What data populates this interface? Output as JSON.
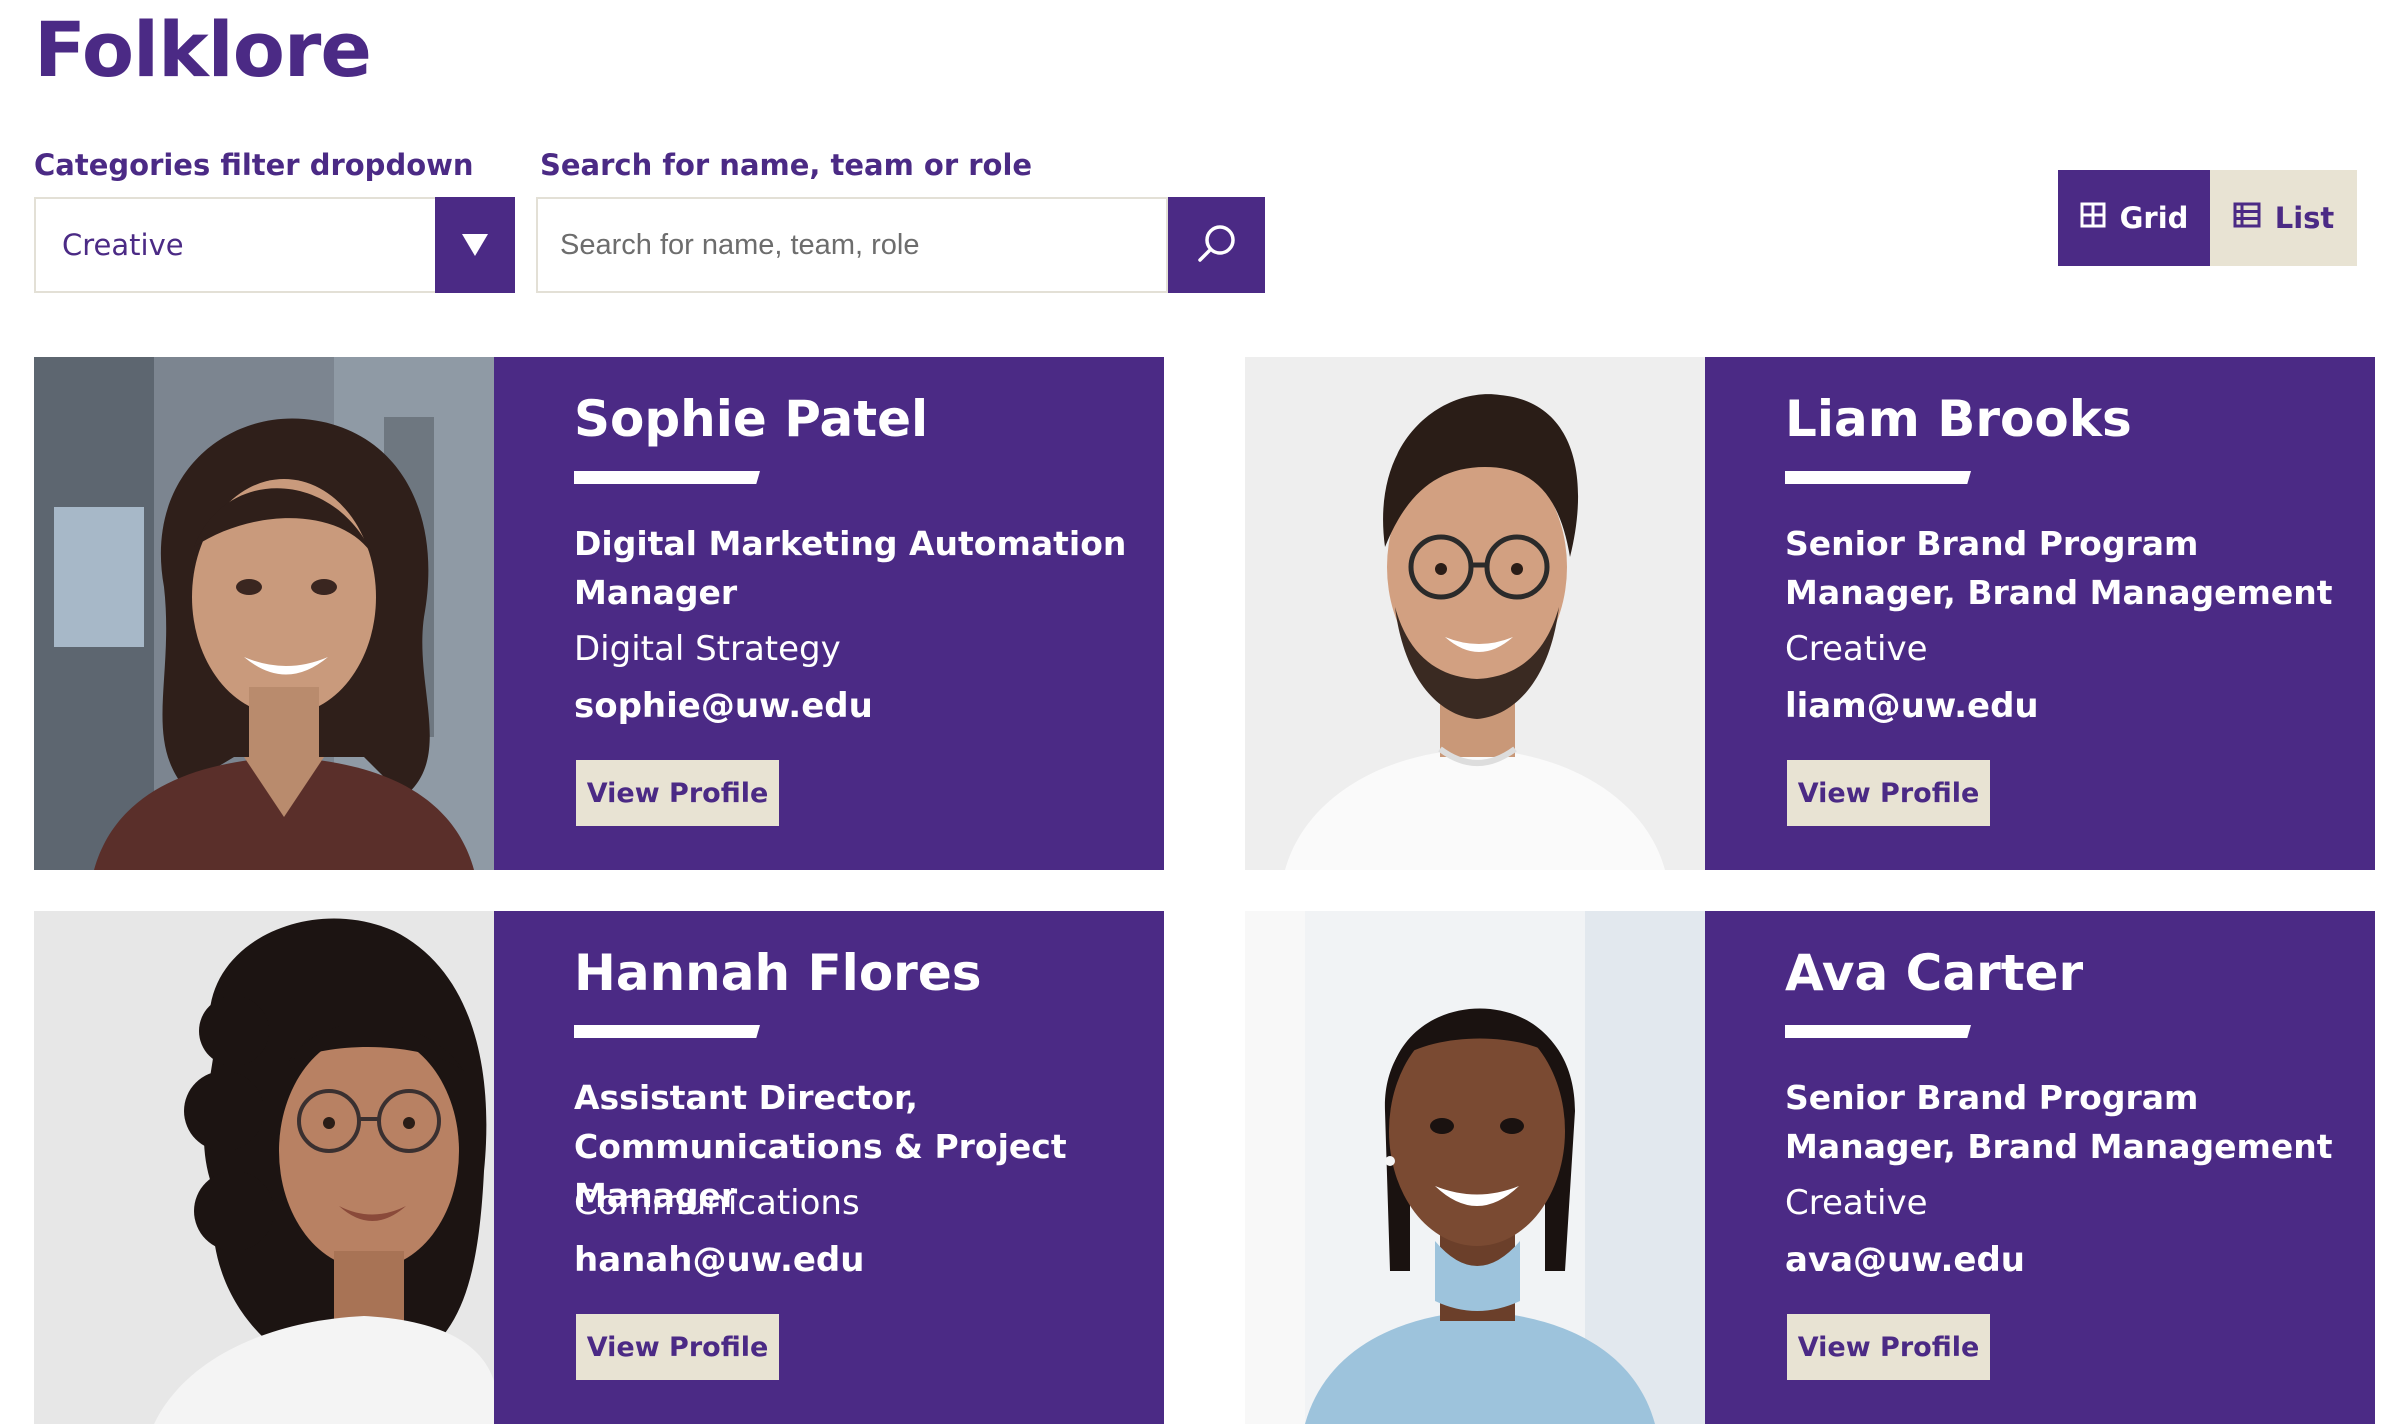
{
  "page": {
    "title": "Folklore"
  },
  "filters": {
    "category_label": "Categories filter dropdown",
    "category_value": "Creative",
    "search_label": "Search for name, team or role",
    "search_placeholder": "Search for name, team, role"
  },
  "view_toggle": {
    "grid_label": "Grid",
    "list_label": "List",
    "selected": "Grid"
  },
  "colors": {
    "brand_purple": "#4b2a85",
    "accent_gold": "#e8e3d3"
  },
  "people": [
    {
      "name": "Sophie Patel",
      "role": "Digital Marketing Automation Manager",
      "department": "Digital Strategy",
      "email": "sophie@uw.edu",
      "button_label": "View Profile"
    },
    {
      "name": "Liam Brooks",
      "role": "Senior Brand Program Manager, Brand Management",
      "department": "Creative",
      "email": "liam@uw.edu",
      "button_label": "View Profile"
    },
    {
      "name": "Hannah Flores",
      "role": "Assistant Director, Communications & Project Manager",
      "department": "Communications",
      "email": "hanah@uw.edu",
      "button_label": "View Profile"
    },
    {
      "name": "Ava Carter",
      "role": "Senior Brand Program Manager, Brand Management",
      "department": "Creative",
      "email": "ava@uw.edu",
      "button_label": "View Profile"
    }
  ]
}
